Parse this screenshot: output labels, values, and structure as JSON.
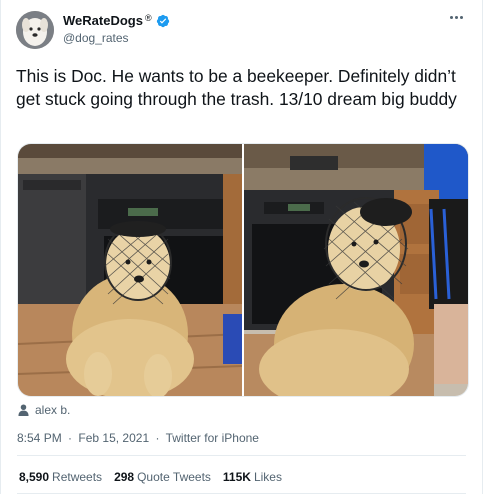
{
  "tweet": {
    "author": {
      "display_name": "WeRateDogs",
      "registered_mark": "®",
      "handle": "@dog_rates",
      "verified": true,
      "avatar_icon": "dog-avatar"
    },
    "more_icon": "ellipsis-icon",
    "text": "This is Doc. He wants to be a beekeeper. Definitely didn’t get stuck going through the trash. 13/10 dream big buddy",
    "media": {
      "photos": [
        "left-photo",
        "right-photo"
      ]
    },
    "tagged_user": "alex b.",
    "timestamp": {
      "time": "8:54 PM",
      "date": "Feb 15, 2021",
      "source": "Twitter for iPhone",
      "separator": "·"
    },
    "stats": {
      "retweets_count": "8,590",
      "retweets_label": "Retweets",
      "quotes_count": "298",
      "quotes_label": "Quote Tweets",
      "likes_count": "115K",
      "likes_label": "Likes"
    }
  },
  "colors": {
    "text_primary": "#0f1419",
    "text_secondary": "#536471",
    "verified_blue": "#1d9bf0",
    "divider": "#e6ecf0"
  }
}
